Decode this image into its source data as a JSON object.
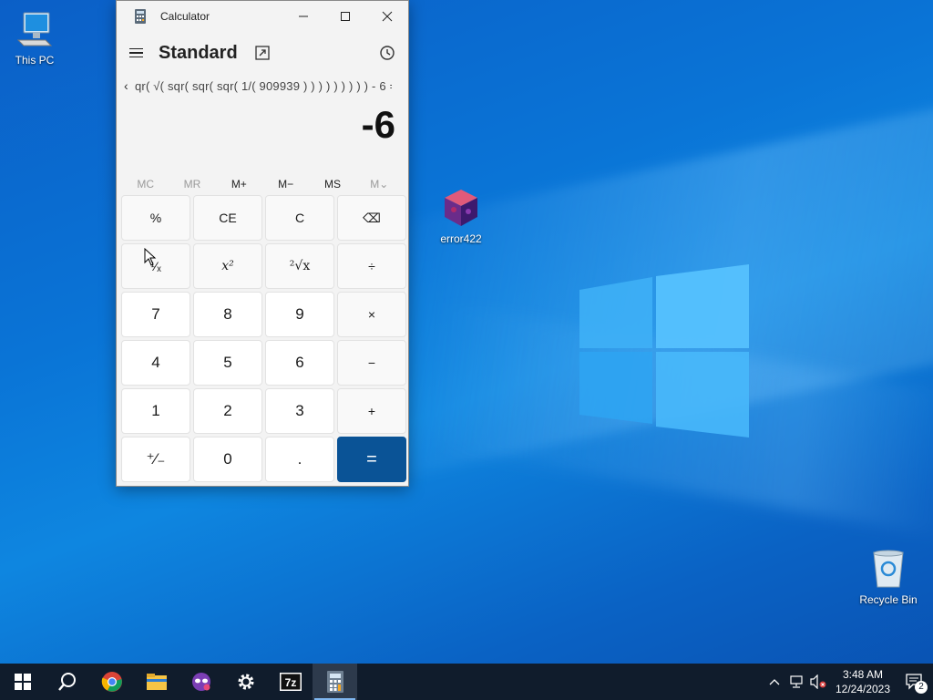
{
  "desktop": {
    "icons": [
      {
        "label": "This PC"
      },
      {
        "label": "error422"
      },
      {
        "label": "Recycle Bin"
      }
    ]
  },
  "calculator": {
    "window_title": "Calculator",
    "mode": "Standard",
    "expression": "qr( √( sqr( sqr( sqr( 1/( 909939 ) ) ) ) ) ) ) ) ) - 6 =",
    "display": "-6",
    "memory": [
      "MC",
      "MR",
      "M+",
      "M−",
      "MS",
      "M⌄"
    ],
    "keys": [
      "%",
      "CE",
      "C",
      "⌫",
      "¹⁄ₓ",
      "x²",
      "²√x",
      "÷",
      "7",
      "8",
      "9",
      "×",
      "4",
      "5",
      "6",
      "−",
      "1",
      "2",
      "3",
      "+",
      "⁺⁄₋",
      "0",
      ".",
      "="
    ]
  },
  "taskbar": {
    "items": [
      "start",
      "search",
      "chrome",
      "file-explorer",
      "app-mask",
      "settings",
      "7zip",
      "calculator"
    ],
    "clock_time": "3:48 AM",
    "clock_date": "12/24/2023",
    "notification_count": "2"
  },
  "colors": {
    "accent": "#0a5396",
    "desktop": "#0a74d6",
    "taskbar": "#101c2c"
  }
}
